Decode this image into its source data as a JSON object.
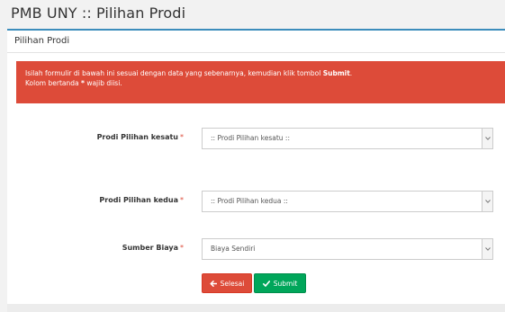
{
  "page": {
    "title": "PMB UNY :: Pilihan Prodi"
  },
  "panel": {
    "title": "Pilihan Prodi"
  },
  "alert": {
    "line1_text": "Isilah formulir di bawah ini sesuai dengan data yang sebenarnya, kemudian klik tombol ",
    "line1_bold": "Submit",
    "line1_end": ".",
    "line2_start": "Kolom bertanda ",
    "line2_bold": "*",
    "line2_end": " wajib diisi.",
    "color": "#dd4b39"
  },
  "form": {
    "required_mark": "*",
    "prodi1": {
      "label": "Prodi Pilihan kesatu",
      "value": ":: Prodi Pilihan kesatu ::"
    },
    "prodi2": {
      "label": "Prodi Pilihan kedua",
      "value": ":: Prodi Pilihan kedua ::"
    },
    "biaya": {
      "label": "Sumber Biaya",
      "value": "Biaya Sendiri"
    }
  },
  "buttons": {
    "selesai": {
      "label": "Selesai",
      "icon": "arrow-left-icon",
      "color": "#dd4b39"
    },
    "submit": {
      "label": "Submit",
      "icon": "check-icon",
      "color": "#00a65a"
    }
  },
  "theme": {
    "accent": "#3c8dbc"
  }
}
